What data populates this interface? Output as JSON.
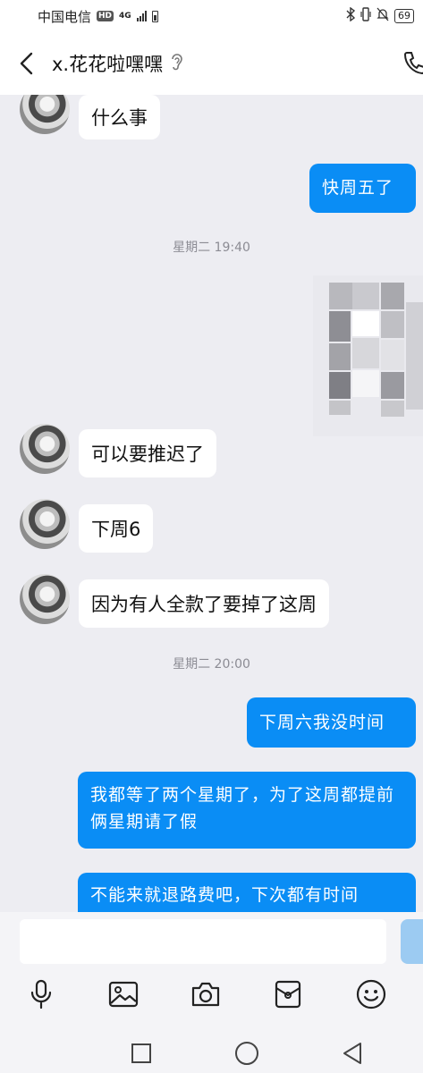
{
  "status_bar": {
    "carrier": "中国电信",
    "hd_badge": "HD",
    "network": "4G",
    "battery": "69",
    "bluetooth_icon": "bluetooth-icon",
    "mute_icon": "bell-off-icon"
  },
  "header": {
    "back_icon": "chevron-left-icon",
    "contact_name": "x.花花啦嘿嘿",
    "ear_icon": "ear-icon",
    "call_icon": "phone-icon"
  },
  "messages": [
    {
      "dir": "in",
      "text": "什么事"
    },
    {
      "dir": "out",
      "text": "快周五了"
    },
    {
      "dir": "ts",
      "text": "星期二 19:40"
    },
    {
      "dir": "in_image",
      "text": ""
    },
    {
      "dir": "in",
      "text": "可以要推迟了"
    },
    {
      "dir": "in",
      "text": "下周6"
    },
    {
      "dir": "in",
      "text": "因为有人全款了要掉了这周"
    },
    {
      "dir": "ts",
      "text": "星期二 20:00"
    },
    {
      "dir": "out",
      "text": "下周六我没时间"
    },
    {
      "dir": "out",
      "text": "我都等了两个星期了，为了这周都提前俩星期请了假"
    },
    {
      "dir": "out",
      "text": "不能来就退路费吧，下次都有时间"
    }
  ],
  "input": {
    "placeholder": "",
    "tools": [
      "microphone-icon",
      "image-icon",
      "camera-icon",
      "red-packet-icon",
      "emoji-icon"
    ]
  },
  "nav": [
    "recent-apps-icon",
    "home-icon",
    "back-icon"
  ],
  "colors": {
    "accent": "#0a8df5",
    "chat_bg": "#ededf2",
    "bubble_in": "#ffffff"
  }
}
